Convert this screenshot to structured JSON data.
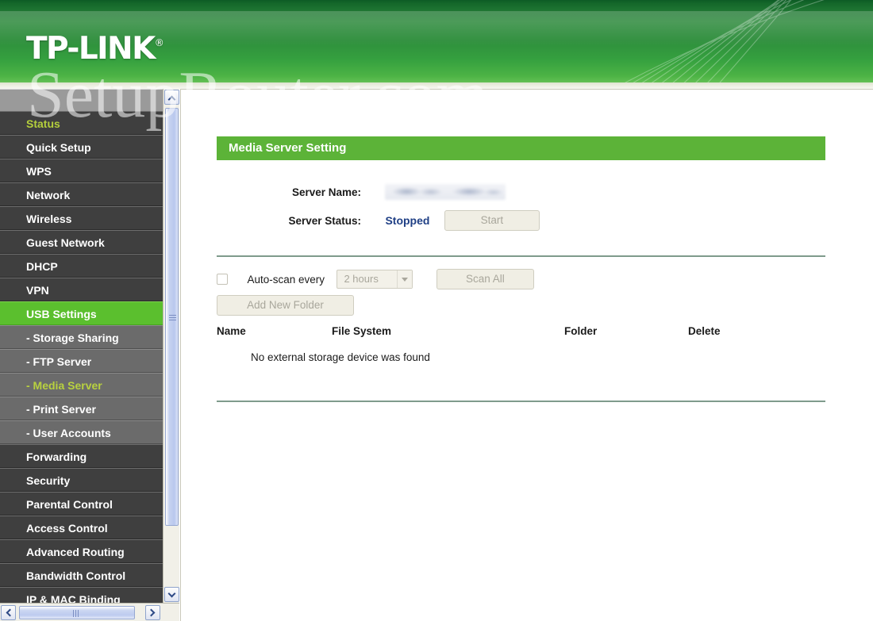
{
  "header": {
    "brand": "TP-LINK",
    "trademark": "®"
  },
  "watermark": {
    "text": "SetupRouter.com"
  },
  "sidebar": {
    "items": [
      {
        "label": "Status",
        "type": "top",
        "state": "active-olive"
      },
      {
        "label": "Quick Setup",
        "type": "top",
        "state": "normal"
      },
      {
        "label": "WPS",
        "type": "top",
        "state": "normal"
      },
      {
        "label": "Network",
        "type": "top",
        "state": "normal"
      },
      {
        "label": "Wireless",
        "type": "top",
        "state": "normal"
      },
      {
        "label": "Guest Network",
        "type": "top",
        "state": "normal"
      },
      {
        "label": "DHCP",
        "type": "top",
        "state": "normal"
      },
      {
        "label": "VPN",
        "type": "top",
        "state": "normal"
      },
      {
        "label": "USB Settings",
        "type": "top",
        "state": "active-green"
      },
      {
        "label": "- Storage Sharing",
        "type": "sub",
        "state": "normal"
      },
      {
        "label": "- FTP Server",
        "type": "sub",
        "state": "normal"
      },
      {
        "label": "- Media Server",
        "type": "sub",
        "state": "active-olive"
      },
      {
        "label": "- Print Server",
        "type": "sub",
        "state": "normal"
      },
      {
        "label": "- User Accounts",
        "type": "sub",
        "state": "normal"
      },
      {
        "label": "Forwarding",
        "type": "top",
        "state": "normal"
      },
      {
        "label": "Security",
        "type": "top",
        "state": "normal"
      },
      {
        "label": "Parental Control",
        "type": "top",
        "state": "normal"
      },
      {
        "label": "Access Control",
        "type": "top",
        "state": "normal"
      },
      {
        "label": "Advanced Routing",
        "type": "top",
        "state": "normal"
      },
      {
        "label": "Bandwidth Control",
        "type": "top",
        "state": "normal"
      },
      {
        "label": "IP & MAC Binding",
        "type": "top",
        "state": "normal"
      }
    ]
  },
  "main": {
    "section_title": "Media Server Setting",
    "server_name_label": "Server Name:",
    "server_name_value": "",
    "server_status_label": "Server Status:",
    "server_status_value": "Stopped",
    "start_button": "Start",
    "autoscan_label": "Auto-scan every",
    "autoscan_checked": false,
    "interval_selected": "2 hours",
    "scan_all_button": "Scan All",
    "add_new_folder_button": "Add New Folder",
    "table_headers": [
      "Name",
      "File System",
      "Folder",
      "Delete"
    ],
    "empty_message": "No external storage device was found"
  },
  "colors": {
    "brand_green": "#5cb338",
    "nav_active_green": "#5bbf2e",
    "nav_active_olive": "#b4cf3c",
    "status_blue": "#1f3f85",
    "divider": "#7f9b8c"
  }
}
